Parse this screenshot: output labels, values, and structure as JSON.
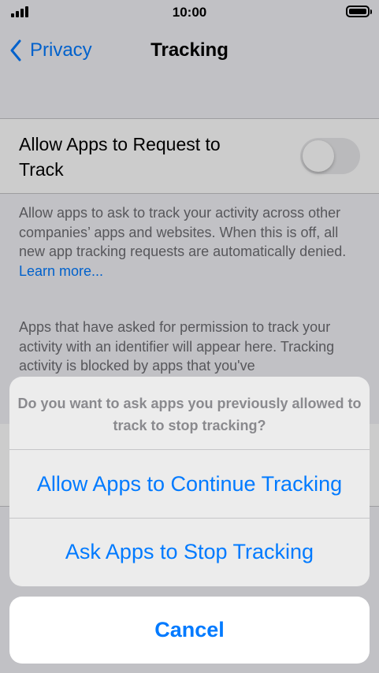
{
  "status_bar": {
    "time": "10:00"
  },
  "nav": {
    "back_label": "Privacy",
    "title": "Tracking"
  },
  "toggle": {
    "label": "Allow Apps to Request to Track",
    "on": false
  },
  "footer": {
    "text": "Allow apps to ask to track your activity across other companies’ apps and websites. When this is off, all new app tracking requests are automatically denied.",
    "link": "Learn more..."
  },
  "info": {
    "text": "Apps that have asked for permission to track your activity with an identifier will appear here. Tracking activity is blocked by apps that you've"
  },
  "action_sheet": {
    "message": "Do you want to ask apps you previously allowed to track to stop tracking?",
    "actions": [
      {
        "label": "Allow Apps to Continue Tracking"
      },
      {
        "label": "Ask Apps to Stop Tracking"
      }
    ],
    "cancel_label": "Cancel"
  },
  "colors": {
    "accent": "#007aff",
    "background": "#f2f2f7",
    "secondary_text": "#6d6d72"
  }
}
